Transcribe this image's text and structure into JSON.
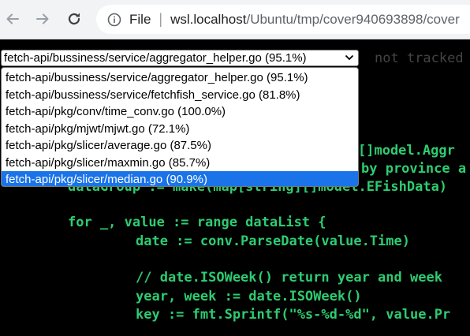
{
  "browser": {
    "back_icon": "arrow-left",
    "forward_icon": "arrow-right",
    "reload_icon": "reload",
    "info_icon": "info-circle",
    "file_label": "File",
    "url_host": "wsl.localhost",
    "url_path": "/Ubuntu/tmp/cover940693898/cover"
  },
  "selector": {
    "selected": "fetch-api/bussiness/service/aggregator_helper.go (95.1%)",
    "options": [
      "fetch-api/bussiness/service/aggregator_helper.go (95.1%)",
      "fetch-api/bussiness/service/fetchfish_service.go (81.8%)",
      "fetch-api/pkg/conv/time_conv.go (100.0%)",
      "fetch-api/pkg/mjwt/mjwt.go (72.1%)",
      "fetch-api/pkg/slicer/average.go (87.5%)",
      "fetch-api/pkg/slicer/maxmin.go (85.7%)",
      "fetch-api/pkg/slicer/median.go (90.9%)"
    ],
    "highlighted_option": "fetch-api/pkg/slicer/median.go (90.9%)"
  },
  "legend": {
    "not_tracked": "not tracked"
  },
  "code": {
    "lines": [
      "[]model.Aggr",
      "by province a",
      "dataGroup := make(map[string][]model.EFishData)",
      "for _, value := range dataList {",
      "date := conv.ParseDate(value.Time)",
      "// date.ISOWeek() return year and week",
      "year, week := date.ISOWeek()",
      "key := fmt.Sprintf(\"%s-%d-%d\", value.Pr"
    ]
  },
  "colors": {
    "covered": "#2ecc71",
    "not_tracked": "#444444",
    "highlight": "#1a73e8"
  }
}
